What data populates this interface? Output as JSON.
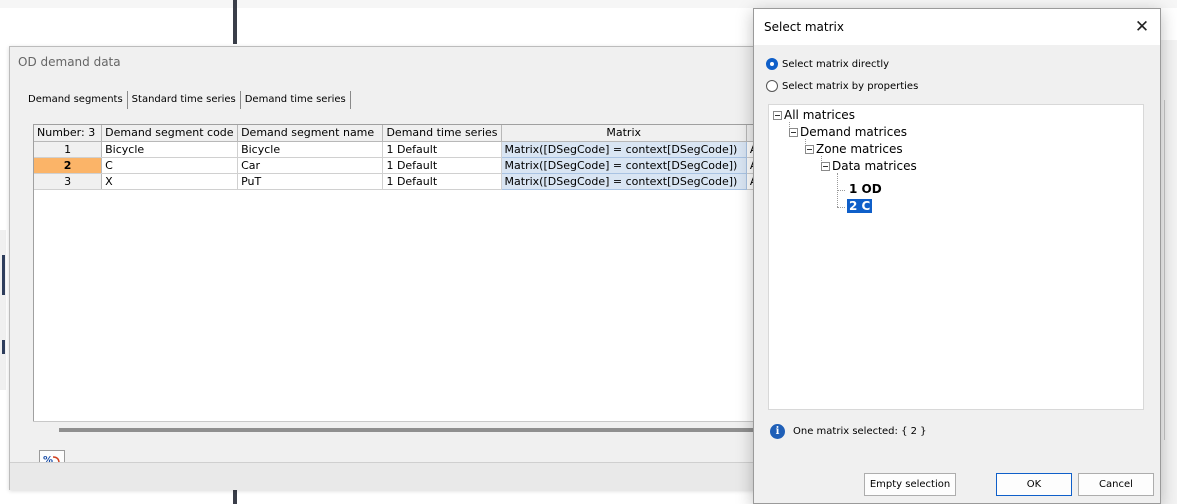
{
  "od_window": {
    "title": "OD demand data",
    "tabs": [
      "Demand segments",
      "Standard time series",
      "Demand time series"
    ],
    "table": {
      "headers": [
        "Number: 3",
        "Demand segment code",
        "Demand segment name",
        "Demand time series",
        "Matrix",
        ""
      ],
      "rows": [
        {
          "num": "1",
          "code": "Bicycle",
          "name": "Bicycle",
          "series": "1 Default",
          "matrix": "Matrix([DSegCode] = context[DSegCode])",
          "extra": "A"
        },
        {
          "num": "2",
          "code": "C",
          "name": "Car",
          "series": "1 Default",
          "matrix": "Matrix([DSegCode] = context[DSegCode])",
          "extra": "A"
        },
        {
          "num": "3",
          "code": "X",
          "name": "PuT",
          "series": "1 Default",
          "matrix": "Matrix([DSegCode] = context[DSegCode])",
          "extra": "A"
        }
      ],
      "selected_row": "2"
    },
    "icon_button_glyph": "%"
  },
  "dialog": {
    "title": "Select matrix",
    "close_glyph": "✕",
    "radio_direct": "Select matrix directly",
    "radio_properties": "Select matrix by properties",
    "selected_radio": "direct",
    "tree": {
      "root": "All matrices",
      "demand": "Demand matrices",
      "zone": "Zone matrices",
      "data": "Data matrices",
      "leaf_1": "1 OD",
      "leaf_2": "2 C"
    },
    "info_glyph": "i",
    "info_text": "One matrix selected: { 2 }",
    "buttons": {
      "empty": "Empty selection",
      "ok": "OK",
      "cancel": "Cancel"
    }
  },
  "colors": {
    "selection_blue": "#0f5fc9",
    "selected_row_orange": "#fbb468",
    "matrix_cell_blue": "#d9e5f3"
  }
}
